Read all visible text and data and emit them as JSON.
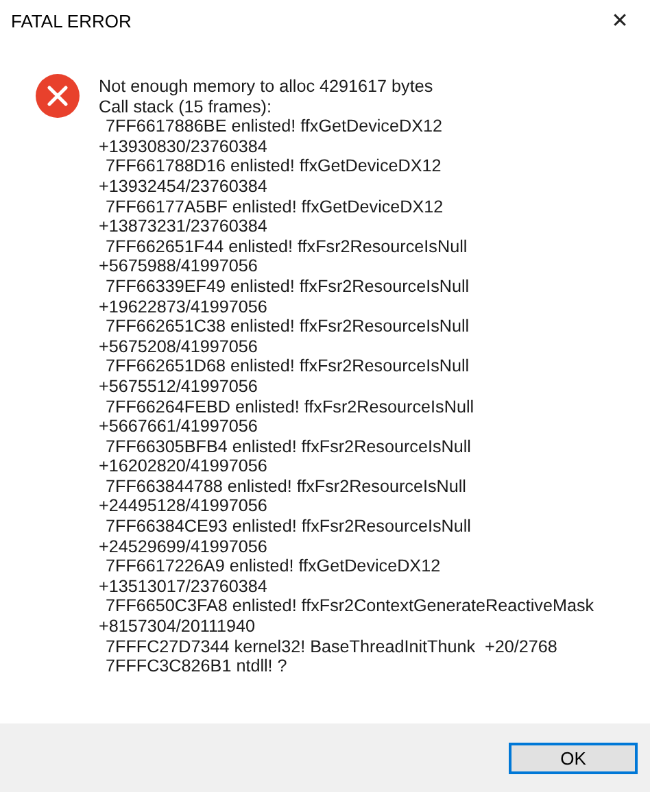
{
  "window": {
    "title": "FATAL ERROR",
    "close": "✕"
  },
  "message": [
    {
      "kind": "text",
      "text": "Not enough memory to alloc 4291617 bytes"
    },
    {
      "kind": "text",
      "text": "Call stack (15 frames):"
    },
    {
      "kind": "frame",
      "text": "7FF6617886BE enlisted! ffxGetDeviceDX12"
    },
    {
      "kind": "text",
      "text": "+13930830/23760384"
    },
    {
      "kind": "frame",
      "text": "7FF661788D16 enlisted! ffxGetDeviceDX12"
    },
    {
      "kind": "text",
      "text": "+13932454/23760384"
    },
    {
      "kind": "frame",
      "text": "7FF66177A5BF enlisted! ffxGetDeviceDX12"
    },
    {
      "kind": "text",
      "text": "+13873231/23760384"
    },
    {
      "kind": "frame",
      "text": "7FF662651F44 enlisted! ffxFsr2ResourceIsNull"
    },
    {
      "kind": "text",
      "text": "+5675988/41997056"
    },
    {
      "kind": "frame",
      "text": "7FF66339EF49 enlisted! ffxFsr2ResourceIsNull"
    },
    {
      "kind": "text",
      "text": "+19622873/41997056"
    },
    {
      "kind": "frame",
      "text": "7FF662651C38 enlisted! ffxFsr2ResourceIsNull"
    },
    {
      "kind": "text",
      "text": "+5675208/41997056"
    },
    {
      "kind": "frame",
      "text": "7FF662651D68 enlisted! ffxFsr2ResourceIsNull"
    },
    {
      "kind": "text",
      "text": "+5675512/41997056"
    },
    {
      "kind": "frame",
      "text": "7FF66264FEBD enlisted! ffxFsr2ResourceIsNull"
    },
    {
      "kind": "text",
      "text": "+5667661/41997056"
    },
    {
      "kind": "frame",
      "text": "7FF66305BFB4 enlisted! ffxFsr2ResourceIsNull"
    },
    {
      "kind": "text",
      "text": "+16202820/41997056"
    },
    {
      "kind": "frame",
      "text": "7FF663844788 enlisted! ffxFsr2ResourceIsNull"
    },
    {
      "kind": "text",
      "text": "+24495128/41997056"
    },
    {
      "kind": "frame",
      "text": "7FF66384CE93 enlisted! ffxFsr2ResourceIsNull"
    },
    {
      "kind": "text",
      "text": "+24529699/41997056"
    },
    {
      "kind": "frame",
      "text": "7FF6617226A9 enlisted! ffxGetDeviceDX12"
    },
    {
      "kind": "text",
      "text": "+13513017/23760384"
    },
    {
      "kind": "frame",
      "text": "7FF6650C3FA8 enlisted! ffxFsr2ContextGenerateReactiveMask"
    },
    {
      "kind": "text",
      "text": "+8157304/20111940"
    },
    {
      "kind": "frame",
      "text": "7FFFC27D7344 kernel32! BaseThreadInitThunk  +20/2768"
    },
    {
      "kind": "frame",
      "text": "7FFFC3C826B1 ntdll! ?"
    }
  ],
  "buttons": [
    {
      "label": "OK",
      "selected": true
    }
  ]
}
